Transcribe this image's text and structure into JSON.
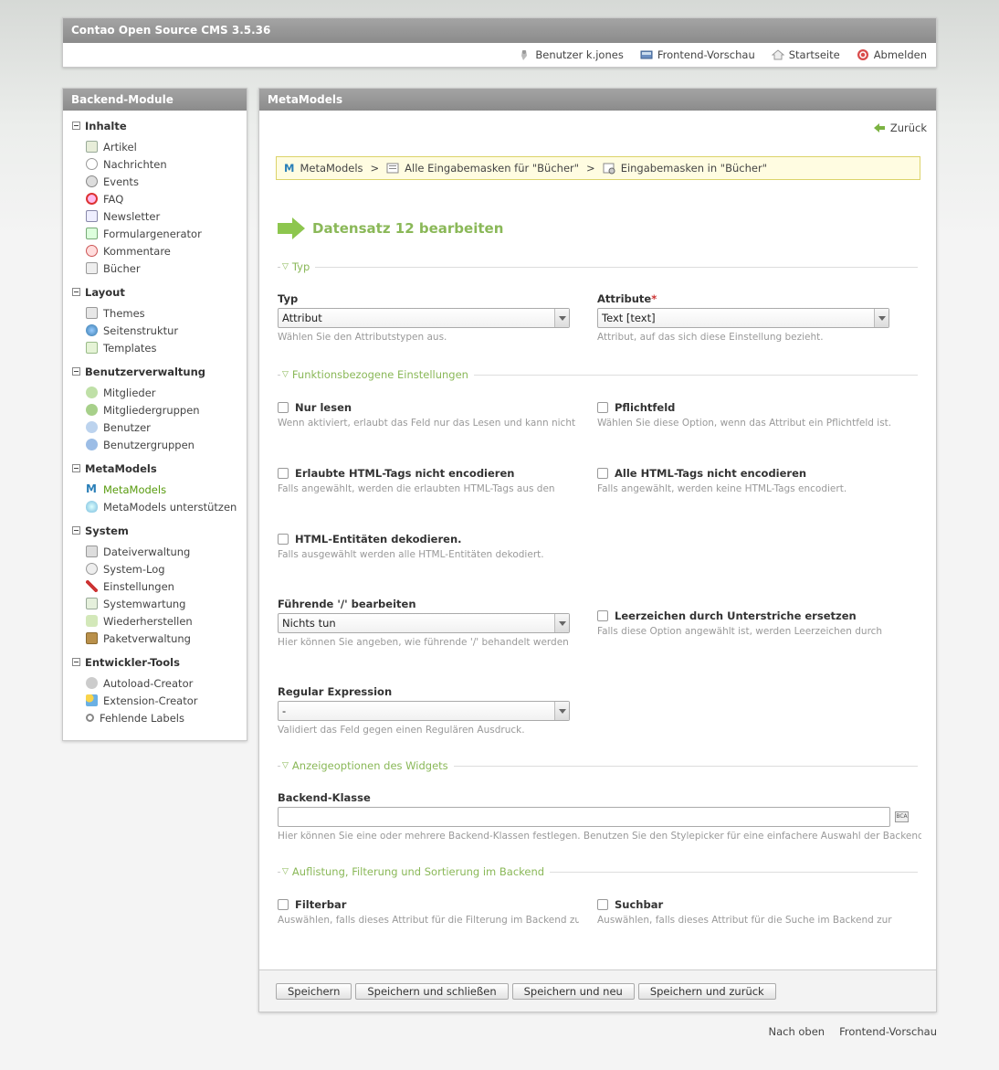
{
  "header": {
    "title": "Contao Open Source CMS 3.5.36",
    "links": [
      {
        "label": "Benutzer k.jones",
        "icon": "user-icon"
      },
      {
        "label": "Frontend-Vorschau",
        "icon": "preview-icon"
      },
      {
        "label": "Startseite",
        "icon": "home-icon"
      },
      {
        "label": "Abmelden",
        "icon": "logout-icon"
      }
    ]
  },
  "sidebar": {
    "title": "Backend-Module",
    "groups": [
      {
        "label": "Inhalte",
        "items": [
          "Artikel",
          "Nachrichten",
          "Events",
          "FAQ",
          "Newsletter",
          "Formulargenerator",
          "Kommentare",
          "Bücher"
        ]
      },
      {
        "label": "Layout",
        "items": [
          "Themes",
          "Seitenstruktur",
          "Templates"
        ]
      },
      {
        "label": "Benutzerverwaltung",
        "items": [
          "Mitglieder",
          "Mitgliedergruppen",
          "Benutzer",
          "Benutzergruppen"
        ]
      },
      {
        "label": "MetaModels",
        "items": [
          "MetaModels",
          "MetaModels unterstützen"
        ]
      },
      {
        "label": "System",
        "items": [
          "Dateiverwaltung",
          "System-Log",
          "Einstellungen",
          "Systemwartung",
          "Wiederherstellen",
          "Paketverwaltung"
        ]
      },
      {
        "label": "Entwickler-Tools",
        "items": [
          "Autoload-Creator",
          "Extension-Creator",
          "Fehlende Labels"
        ]
      }
    ]
  },
  "main": {
    "title": "MetaModels",
    "back": "Zurück",
    "breadcrumb": [
      "MetaModels",
      ">",
      "Alle Eingabemasken für \"Bücher\"",
      ">",
      "Eingabemasken in \"Bücher\""
    ],
    "heading": "Datensatz 12 bearbeiten",
    "legends": {
      "typ": "Typ",
      "func": "Funktionsbezogene Einstellungen",
      "display": "Anzeigeoptionen des Widgets",
      "list": "Auflistung, Filterung und Sortierung im Backend"
    },
    "typ": {
      "label": "Typ",
      "value": "Attribut",
      "help": "Wählen Sie den Attributstypen aus."
    },
    "attribute": {
      "label": "Attribute",
      "required": "*",
      "value": "Text [text]",
      "help": "Attribut, auf das sich diese Einstellung bezieht."
    },
    "readonly": {
      "label": "Nur lesen",
      "help": "Wenn aktiviert, erlaubt das Feld nur das Lesen und kann nicht"
    },
    "mandatory": {
      "label": "Pflichtfeld",
      "help": "Wählen Sie diese Option, wenn das Attribut ein Pflichtfeld ist."
    },
    "allowhtml": {
      "label": "Erlaubte HTML-Tags nicht encodieren",
      "help": "Falls angewählt, werden die erlaubten HTML-Tags aus den"
    },
    "preservetags": {
      "label": "Alle HTML-Tags nicht encodieren",
      "help": "Falls angewählt, werden keine HTML-Tags encodiert."
    },
    "decode": {
      "label": "HTML-Entitäten dekodieren.",
      "help": "Falls ausgewählt werden alle HTML-Entitäten dekodiert."
    },
    "trailing": {
      "label": "Führende '/' bearbeiten",
      "value": "Nichts tun",
      "help": "Hier können Sie angeben, wie führende '/' behandelt werden"
    },
    "spaces": {
      "label": "Leerzeichen durch Unterstriche ersetzen",
      "help": "Falls diese Option angewählt ist, werden Leerzeichen durch"
    },
    "rgxp": {
      "label": "Regular Expression",
      "value": "-",
      "help": "Validiert das Feld gegen einen Regulären Ausdruck."
    },
    "tlclass": {
      "label": "Backend-Klasse",
      "value": "",
      "help": "Hier können Sie eine oder mehrere Backend-Klassen festlegen. Benutzen Sie den Stylepicker für eine einfachere Auswahl der Backend-"
    },
    "filterable": {
      "label": "Filterbar",
      "help": "Auswählen, falls dieses Attribut für die Filterung im Backend zur"
    },
    "searchable": {
      "label": "Suchbar",
      "help": "Auswählen, falls dieses Attribut für die Suche im Backend zur"
    },
    "buttons": {
      "save": "Speichern",
      "saveclose": "Speichern und schließen",
      "savenew": "Speichern und neu",
      "saveback": "Speichern und zurück"
    }
  },
  "footer": {
    "top": "Nach oben",
    "preview": "Frontend-Vorschau"
  }
}
